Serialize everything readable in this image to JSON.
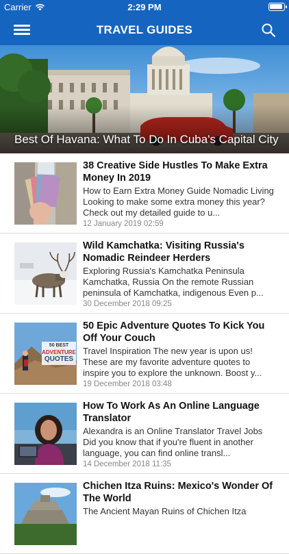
{
  "status_bar": {
    "carrier": "Carrier",
    "time": "2:29 PM",
    "battery_level": 0.95
  },
  "navbar": {
    "title": "TRAVEL GUIDES",
    "menu_icon": "hamburger-icon",
    "search_icon": "search-icon"
  },
  "hero": {
    "title": "Best Of Havana: What To Do In Cuba's Capital City"
  },
  "articles": [
    {
      "title": "38 Creative Side Hustles To Make Extra Money In 2019",
      "excerpt": "How to Earn Extra Money Guide   Nomadic Living  Looking to make some extra money this year? Check out my detailed guide to u...",
      "date": "12 January 2019 02:59"
    },
    {
      "title": "Wild Kamchatka: Visiting Russia's Nomadic Reindeer Herders",
      "excerpt": "Exploring Russia's Kamchatka Peninsula Kamchatka, Russia  On the remote Russian peninsula of Kamchatka, indigenous Even p...",
      "date": "30 December 2018 09:25"
    },
    {
      "title": "50 Epic Adventure Quotes To Kick You Off Your Couch",
      "excerpt": "Travel Inspiration  The new year is upon us! These are my favorite adventure quotes to inspire you to explore the unknown. Boost y...",
      "date": "19 December 2018 03:48",
      "thumb_text": [
        "50 BEST",
        "ADVENTURE",
        "QUOTES"
      ]
    },
    {
      "title": "How To Work As An Online Language Translator",
      "excerpt": "Alexandra is an Online Translator   Travel Jobs  Did you know that if you're fluent in another language, you can find online transl...",
      "date": "14 December 2018 11:35"
    },
    {
      "title": "Chichen Itza Ruins: Mexico's Wonder Of The World",
      "excerpt": "The Ancient Mayan Ruins of Chichen Itza",
      "date": ""
    }
  ]
}
